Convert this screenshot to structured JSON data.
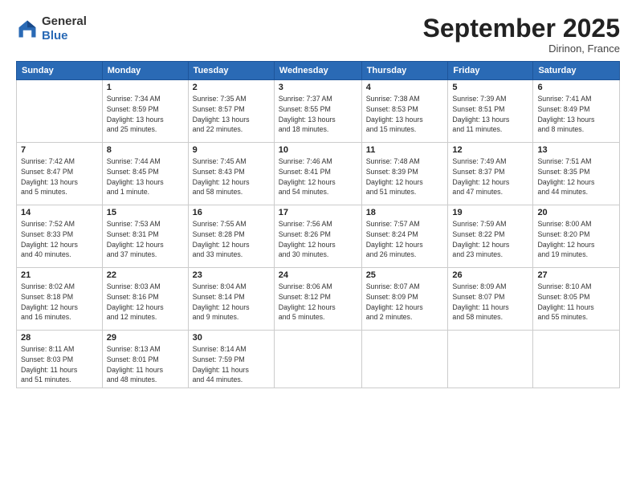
{
  "header": {
    "logo": {
      "line1": "General",
      "line2": "Blue"
    },
    "title": "September 2025",
    "location": "Dirinon, France"
  },
  "weekdays": [
    "Sunday",
    "Monday",
    "Tuesday",
    "Wednesday",
    "Thursday",
    "Friday",
    "Saturday"
  ],
  "weeks": [
    [
      {
        "day": "",
        "info": ""
      },
      {
        "day": "1",
        "info": "Sunrise: 7:34 AM\nSunset: 8:59 PM\nDaylight: 13 hours\nand 25 minutes."
      },
      {
        "day": "2",
        "info": "Sunrise: 7:35 AM\nSunset: 8:57 PM\nDaylight: 13 hours\nand 22 minutes."
      },
      {
        "day": "3",
        "info": "Sunrise: 7:37 AM\nSunset: 8:55 PM\nDaylight: 13 hours\nand 18 minutes."
      },
      {
        "day": "4",
        "info": "Sunrise: 7:38 AM\nSunset: 8:53 PM\nDaylight: 13 hours\nand 15 minutes."
      },
      {
        "day": "5",
        "info": "Sunrise: 7:39 AM\nSunset: 8:51 PM\nDaylight: 13 hours\nand 11 minutes."
      },
      {
        "day": "6",
        "info": "Sunrise: 7:41 AM\nSunset: 8:49 PM\nDaylight: 13 hours\nand 8 minutes."
      }
    ],
    [
      {
        "day": "7",
        "info": "Sunrise: 7:42 AM\nSunset: 8:47 PM\nDaylight: 13 hours\nand 5 minutes."
      },
      {
        "day": "8",
        "info": "Sunrise: 7:44 AM\nSunset: 8:45 PM\nDaylight: 13 hours\nand 1 minute."
      },
      {
        "day": "9",
        "info": "Sunrise: 7:45 AM\nSunset: 8:43 PM\nDaylight: 12 hours\nand 58 minutes."
      },
      {
        "day": "10",
        "info": "Sunrise: 7:46 AM\nSunset: 8:41 PM\nDaylight: 12 hours\nand 54 minutes."
      },
      {
        "day": "11",
        "info": "Sunrise: 7:48 AM\nSunset: 8:39 PM\nDaylight: 12 hours\nand 51 minutes."
      },
      {
        "day": "12",
        "info": "Sunrise: 7:49 AM\nSunset: 8:37 PM\nDaylight: 12 hours\nand 47 minutes."
      },
      {
        "day": "13",
        "info": "Sunrise: 7:51 AM\nSunset: 8:35 PM\nDaylight: 12 hours\nand 44 minutes."
      }
    ],
    [
      {
        "day": "14",
        "info": "Sunrise: 7:52 AM\nSunset: 8:33 PM\nDaylight: 12 hours\nand 40 minutes."
      },
      {
        "day": "15",
        "info": "Sunrise: 7:53 AM\nSunset: 8:31 PM\nDaylight: 12 hours\nand 37 minutes."
      },
      {
        "day": "16",
        "info": "Sunrise: 7:55 AM\nSunset: 8:28 PM\nDaylight: 12 hours\nand 33 minutes."
      },
      {
        "day": "17",
        "info": "Sunrise: 7:56 AM\nSunset: 8:26 PM\nDaylight: 12 hours\nand 30 minutes."
      },
      {
        "day": "18",
        "info": "Sunrise: 7:57 AM\nSunset: 8:24 PM\nDaylight: 12 hours\nand 26 minutes."
      },
      {
        "day": "19",
        "info": "Sunrise: 7:59 AM\nSunset: 8:22 PM\nDaylight: 12 hours\nand 23 minutes."
      },
      {
        "day": "20",
        "info": "Sunrise: 8:00 AM\nSunset: 8:20 PM\nDaylight: 12 hours\nand 19 minutes."
      }
    ],
    [
      {
        "day": "21",
        "info": "Sunrise: 8:02 AM\nSunset: 8:18 PM\nDaylight: 12 hours\nand 16 minutes."
      },
      {
        "day": "22",
        "info": "Sunrise: 8:03 AM\nSunset: 8:16 PM\nDaylight: 12 hours\nand 12 minutes."
      },
      {
        "day": "23",
        "info": "Sunrise: 8:04 AM\nSunset: 8:14 PM\nDaylight: 12 hours\nand 9 minutes."
      },
      {
        "day": "24",
        "info": "Sunrise: 8:06 AM\nSunset: 8:12 PM\nDaylight: 12 hours\nand 5 minutes."
      },
      {
        "day": "25",
        "info": "Sunrise: 8:07 AM\nSunset: 8:09 PM\nDaylight: 12 hours\nand 2 minutes."
      },
      {
        "day": "26",
        "info": "Sunrise: 8:09 AM\nSunset: 8:07 PM\nDaylight: 11 hours\nand 58 minutes."
      },
      {
        "day": "27",
        "info": "Sunrise: 8:10 AM\nSunset: 8:05 PM\nDaylight: 11 hours\nand 55 minutes."
      }
    ],
    [
      {
        "day": "28",
        "info": "Sunrise: 8:11 AM\nSunset: 8:03 PM\nDaylight: 11 hours\nand 51 minutes."
      },
      {
        "day": "29",
        "info": "Sunrise: 8:13 AM\nSunset: 8:01 PM\nDaylight: 11 hours\nand 48 minutes."
      },
      {
        "day": "30",
        "info": "Sunrise: 8:14 AM\nSunset: 7:59 PM\nDaylight: 11 hours\nand 44 minutes."
      },
      {
        "day": "",
        "info": ""
      },
      {
        "day": "",
        "info": ""
      },
      {
        "day": "",
        "info": ""
      },
      {
        "day": "",
        "info": ""
      }
    ]
  ]
}
